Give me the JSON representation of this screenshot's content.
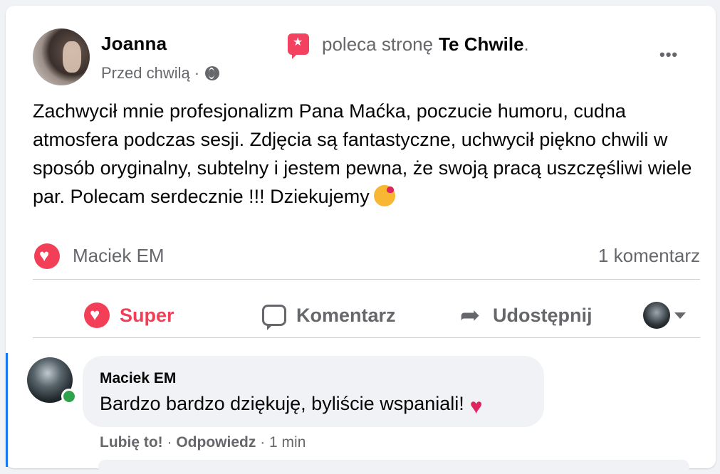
{
  "post": {
    "author": "Joanna",
    "recommend_prefix": "poleca stronę",
    "page_name": "Te Chwile",
    "recommend_suffix": ".",
    "timestamp": "Przed chwilą",
    "separator": "·",
    "more": "•••",
    "body": "Zachwycił mnie profesjonalizm Pana Maćka,  poczucie humoru, cudna atmosfera podczas sesji. Zdjęcia są fantastyczne, uchwycił piękno chwili w sposób oryginalny, subtelny i jestem pewna, że swoją pracą uszczęśliwi wiele par. Polecam serdecznie !!! Dziekujemy"
  },
  "reactions": {
    "reactor": "Maciek EM",
    "comments_count": "1 komentarz"
  },
  "actions": {
    "super": "Super",
    "comment": "Komentarz",
    "share": "Udostępnij"
  },
  "comment": {
    "author": "Maciek EM",
    "text": "Bardzo bardzo dziękuję, byliście wspaniali!",
    "like": "Lubię to!",
    "reply": "Odpowiedz",
    "time": "1 min",
    "sep": "·"
  },
  "colors": {
    "accent_red": "#f33e58",
    "secondary_text": "#65676b",
    "online": "#31a24c",
    "thread": "#1877f2"
  },
  "icons": [
    "globe-icon",
    "recommend-icon",
    "heart-reaction-icon",
    "comment-icon",
    "share-icon",
    "caret-down-icon"
  ]
}
